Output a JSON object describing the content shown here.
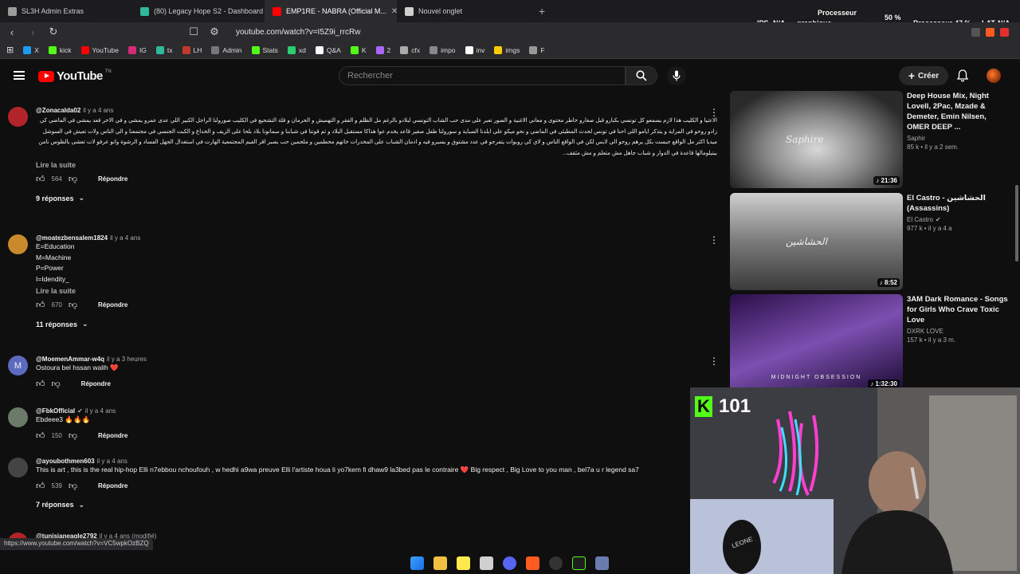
{
  "tabs": [
    {
      "label": "SL3H Admin Extras",
      "color": "#9c9c9c",
      "active": false
    },
    {
      "label": "(80) Legacy Hope S2 - Dashboard",
      "color": "#2fb89a",
      "active": false
    },
    {
      "label": "EMP1RE - NABRA (Official M...",
      "color": "#ff0000",
      "active": true
    },
    {
      "label": "Nouvel onglet",
      "color": "#cfcfcf",
      "active": false
    }
  ],
  "overlay": {
    "ips_label": "IPS",
    "ips_value": "N/A",
    "gpu_label": "graphique",
    "gpu_title": "Processeur",
    "gpu_value": "50 %",
    "cpu_label": "Processeur",
    "cpu_value": "47 %",
    "lat_label": "LAT",
    "lat_value": "N/A"
  },
  "address": {
    "url": "youtube.com/watch?v=I5Z9i_rrcRw"
  },
  "bookmarks": [
    {
      "label": "X",
      "color": "#1d9bf0"
    },
    {
      "label": "kick",
      "color": "#53fc18"
    },
    {
      "label": "YouTube",
      "color": "#ff0000"
    },
    {
      "label": "IG",
      "color": "#d62976"
    },
    {
      "label": "tx",
      "color": "#2fb89a"
    },
    {
      "label": "LH",
      "color": "#c0392b"
    },
    {
      "label": "Admin",
      "color": "#777777"
    },
    {
      "label": "Stats",
      "color": "#53fc18"
    },
    {
      "label": "xd",
      "color": "#2ecc71"
    },
    {
      "label": "Q&A",
      "color": "#ffffff"
    },
    {
      "label": "K",
      "color": "#53fc18"
    },
    {
      "label": "2",
      "color": "#aa66ff"
    },
    {
      "label": "cfx",
      "color": "#aaaaaa"
    },
    {
      "label": "impo",
      "color": "#888888"
    },
    {
      "label": "inv",
      "color": "#ffffff"
    },
    {
      "label": "imgs",
      "color": "#ffcc00"
    },
    {
      "label": "F",
      "color": "#999999"
    }
  ],
  "header": {
    "logo_text": "YouTube",
    "logo_region": "TN",
    "search_placeholder": "Rechercher",
    "create_label": "Créer"
  },
  "comments": [
    {
      "author": "@Zonacalda02",
      "time": "il y a 4 ans",
      "avatar_color": "#b3232a",
      "avatar_letter": "",
      "rtl": true,
      "text": "الاعتيا و الكليب هذا لازم يسمعو كل تونسي بكبارو قبل صغارو خاطر محتوى و معاني الاغنية و الصور تعبر على مدى حب الشاب التونسي لبلادو بالرغم مل الظلم و الفقر و التهميش و الحرمان و قلة التشجيع في الكليب صورولنا الراجل الكبير اللي عدى عمرو يمشي و في الاخر قعد يمشي في الماضي كي زادو روحو في المراية و يتذكر ايامو اللي احنا في تونس لحدث المطيئي في الماضي و نحو ميكو على ابلدنا الصباية و سورولنا طفل صغير قاعد يخدم عوا هذاكا مستقبل البلاد و ثم قوتنا في شبابنا و سمانونا بلاد بلحا على الزيف و الخداع و الكبت الجنسي في مجتمعنا و الي الناس ولات تعيش في السوشل ميديا اكثر مل الواقع جبست بكل يرهم روحو الي لابس لكن في الواقع الناس و لاي كي روبوات يتفرجو في عدد مشتوق و يسيرو فيه و ادمان الشباب على المخدرات خاتهم محطمين و ملجمين حب بصبر اقر الفيم المجتمعية الهارت في استغدال الجهل الفساد و الرشوة وانو عرفو لات تعشى بالظوس نامن بيتيلومالها قاعدة في الدوار و شباب جاهل مش متعلم و مش مثقف...",
      "read_more": "Lire la suite",
      "likes": "564",
      "reply_label": "Répondre",
      "replies_label": "9 réponses"
    },
    {
      "author": "@moatezbensalem1824",
      "time": "il y a 4 ans",
      "avatar_color": "#c98a2b",
      "avatar_letter": "",
      "rtl": false,
      "lines": [
        "E=Education",
        "M=Machine",
        "P=Power",
        "I=Idendity_"
      ],
      "read_more": "Lire la suite",
      "likes": "670",
      "reply_label": "Répondre",
      "replies_label": "11 réponses"
    },
    {
      "author": "@MoemenAmmar-w4q",
      "time": "il y a 3 heures",
      "avatar_color": "#5c6bc0",
      "avatar_letter": "M",
      "rtl": false,
      "lines": [
        "Ostoura bel hssan walih ❤️"
      ],
      "likes": "",
      "reply_label": "Répondre"
    },
    {
      "author": "@FbkOfficial",
      "time": "il y a 4 ans",
      "avatar_color": "#6c7a6a",
      "avatar_letter": "",
      "verified": true,
      "rtl": false,
      "lines": [
        "Ebdeee3 🔥🔥🔥"
      ],
      "likes": "150",
      "reply_label": "Répondre"
    },
    {
      "author": "@ayoubothmen603",
      "time": "il y a 4 ans",
      "avatar_color": "#444444",
      "avatar_letter": "",
      "rtl": false,
      "lines": [
        "This is art , this is the real hip-hop Elli n7ebbou nchoufouh , w hedhi a9wa preuve Elli l'artiste houa li yo7kem fi dhaw9 la3bed pas le contraire ❤️ Big respect , Big Love to you man , bel7a u r legend sa7"
      ],
      "likes": "539",
      "reply_label": "Répondre",
      "replies_label": "7 réponses"
    },
    {
      "author": "@tunisianeagle2792",
      "time": "il y a 4 ans (modifié)",
      "avatar_color": "#b3232a",
      "avatar_letter": "",
      "rtl": false,
      "lines": [],
      "likes": "",
      "reply_label": ""
    }
  ],
  "recommendations": [
    {
      "title": "Deep House Mix, Night Lovell, 2Pac, Mzade & Demeter, Emin Nilsen, OMER DEEP ...",
      "channel": "Saphir",
      "meta": "85 k • il y a 2 sem.",
      "duration": "21:36",
      "thumb_text": "Saphire"
    },
    {
      "title": "El Castro - الحشاشين (Assassins)",
      "channel": "El Castro",
      "meta": "977 k • il y a 4 a",
      "duration": "8:52",
      "verified": true,
      "thumb_text": "الحشاشين"
    },
    {
      "title": "3AM Dark Romance - Songs for Girls Who Crave Toxic Love",
      "channel": "DXRK LOVE",
      "meta": "157 k • il y a 3 m.",
      "duration": "1:32:30",
      "thumb_text": "MIDNIGHT OBSESSION"
    }
  ],
  "webcam": {
    "platform_letter": "K",
    "viewer_count": "101",
    "brand": "#53fc18",
    "glove_text": "LEONE"
  },
  "status_url": "https://www.youtube.com/watch?v=VC5wpkOzBZQ"
}
